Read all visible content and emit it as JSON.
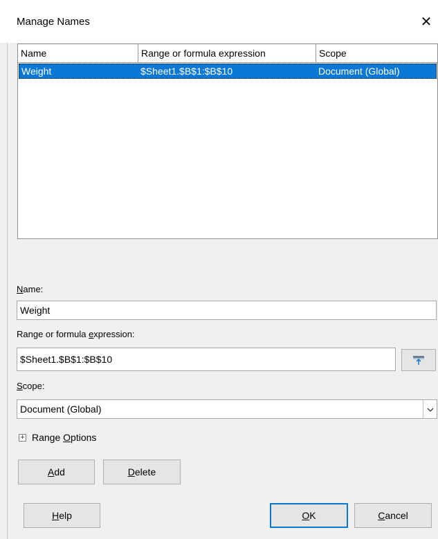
{
  "dialog": {
    "title": "Manage Names",
    "close_glyph": "✕"
  },
  "table": {
    "columns": [
      "Name",
      "Range or formula expression",
      "Scope"
    ],
    "rows": [
      {
        "name": "Weight",
        "range": "$Sheet1.$B$1:$B$10",
        "scope": "Document (Global)",
        "selected": true
      }
    ]
  },
  "form": {
    "name_label_u": "N",
    "name_label_rest": "ame:",
    "name_value": "Weight",
    "range_label_pre": "Range or formula ",
    "range_label_u": "e",
    "range_label_post": "xpression:",
    "range_value": "$Sheet1.$B$1:$B$10",
    "scope_label_u": "S",
    "scope_label_rest": "cope:",
    "scope_value": "Document (Global)",
    "range_options_pre": "Range ",
    "range_options_u": "O",
    "range_options_post": "ptions"
  },
  "buttons": {
    "add_u": "A",
    "add_rest": "dd",
    "delete_u": "D",
    "delete_rest": "elete",
    "help_u": "H",
    "help_rest": "elp",
    "ok_u": "O",
    "ok_rest": "K",
    "cancel_u": "C",
    "cancel_rest": "ancel"
  },
  "icons": {
    "close": "close-icon",
    "shrink": "shrink-icon",
    "dropdown": "chevron-down-icon",
    "expander": "plus-box-icon"
  },
  "colors": {
    "selection": "#0a78d4",
    "default_button_border": "#0078d7"
  }
}
